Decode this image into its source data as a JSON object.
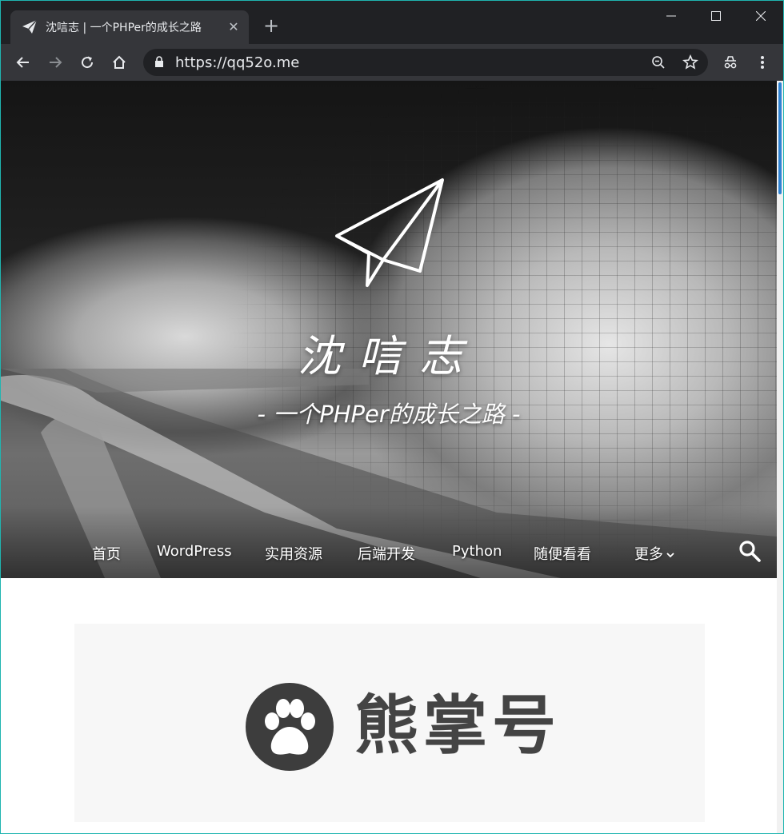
{
  "browser": {
    "tab_title": "沈唁志 | 一个PHPer的成长之路",
    "tab_close_glyph": "✕",
    "new_tab_glyph": "+",
    "url": "https://qq52o.me",
    "icons": [
      "paper-plane-favicon",
      "back-arrow",
      "forward-arrow",
      "reload",
      "home",
      "lock",
      "zoom-out",
      "star-bookmark",
      "incognito-extension",
      "kebab-menu",
      "minimize",
      "maximize",
      "close"
    ]
  },
  "hero": {
    "site_title": "沈唁志",
    "tagline": "- 一个PHPer的成长之路 -",
    "logo_icon": "paper-plane"
  },
  "nav": {
    "items": [
      {
        "label": "首页"
      },
      {
        "label": "WordPress"
      },
      {
        "label": "实用资源"
      },
      {
        "label": "后端开发"
      },
      {
        "label": "Python"
      },
      {
        "label": "随便看看"
      },
      {
        "label": "更多"
      }
    ],
    "search_icon": "search"
  },
  "banner": {
    "text": "熊掌号",
    "icon": "paw"
  },
  "colors": {
    "titlebar": "#202124",
    "toolbar": "#35363a",
    "scroll_accent": "#2f83d3",
    "window_border": "#1fb5b0"
  }
}
